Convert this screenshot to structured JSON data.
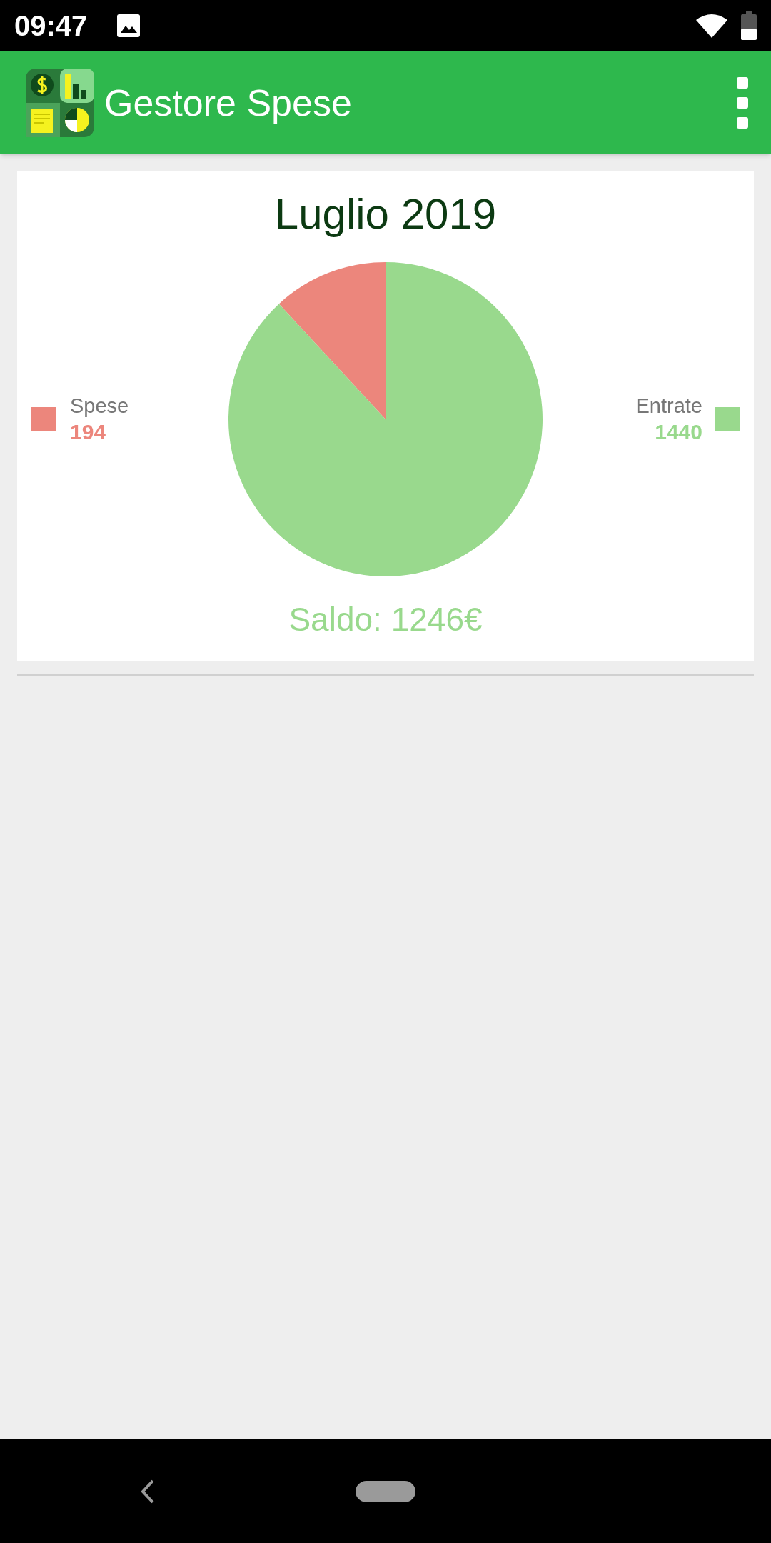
{
  "status_bar": {
    "time": "09:47"
  },
  "app_bar": {
    "title": "Gestore Spese"
  },
  "card": {
    "title": "Luglio 2019",
    "legend": [
      {
        "label": "Spese",
        "value": "194",
        "color": "#ec867c"
      },
      {
        "label": "Entrate",
        "value": "1440",
        "color": "#99d98d"
      }
    ],
    "chart_data": {
      "type": "pie",
      "values": [
        11.87,
        88.13
      ]
    },
    "balance": "Saldo: 1246€"
  }
}
